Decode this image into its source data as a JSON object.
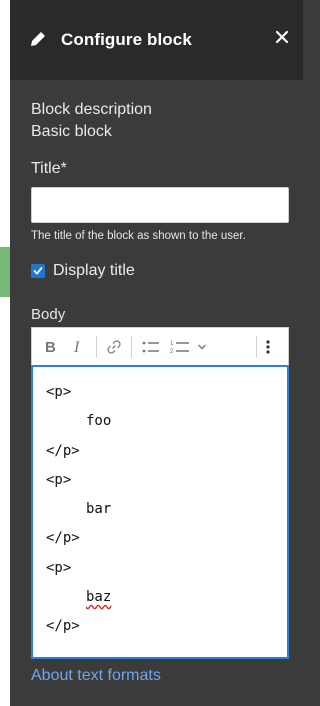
{
  "dialog": {
    "title": "Configure block",
    "close_icon": "close-icon"
  },
  "block": {
    "description_label": "Block description",
    "description_value": "Basic block"
  },
  "title_field": {
    "label": "Title*",
    "value": "",
    "help": "The title of the block as shown to the user."
  },
  "display_title": {
    "label": "Display title",
    "checked": true
  },
  "body_field": {
    "label": "Body",
    "toolbar": [
      "bold-icon",
      "italic-icon",
      "link-icon",
      "bulleted-list-icon",
      "numbered-list-icon",
      "chevron-down-icon",
      "more-options-icon"
    ],
    "lines": [
      "<p>",
      "foo",
      "</p>",
      "<p>",
      "bar",
      "</p>",
      "<p>",
      "baz",
      "</p>"
    ]
  },
  "links": {
    "about_text_formats": "About text formats"
  },
  "colors": {
    "panel_bg": "#3b3b3b",
    "header_bg": "#2a2a2a",
    "link": "#6ea6e8",
    "accent": "#1f77d0"
  }
}
